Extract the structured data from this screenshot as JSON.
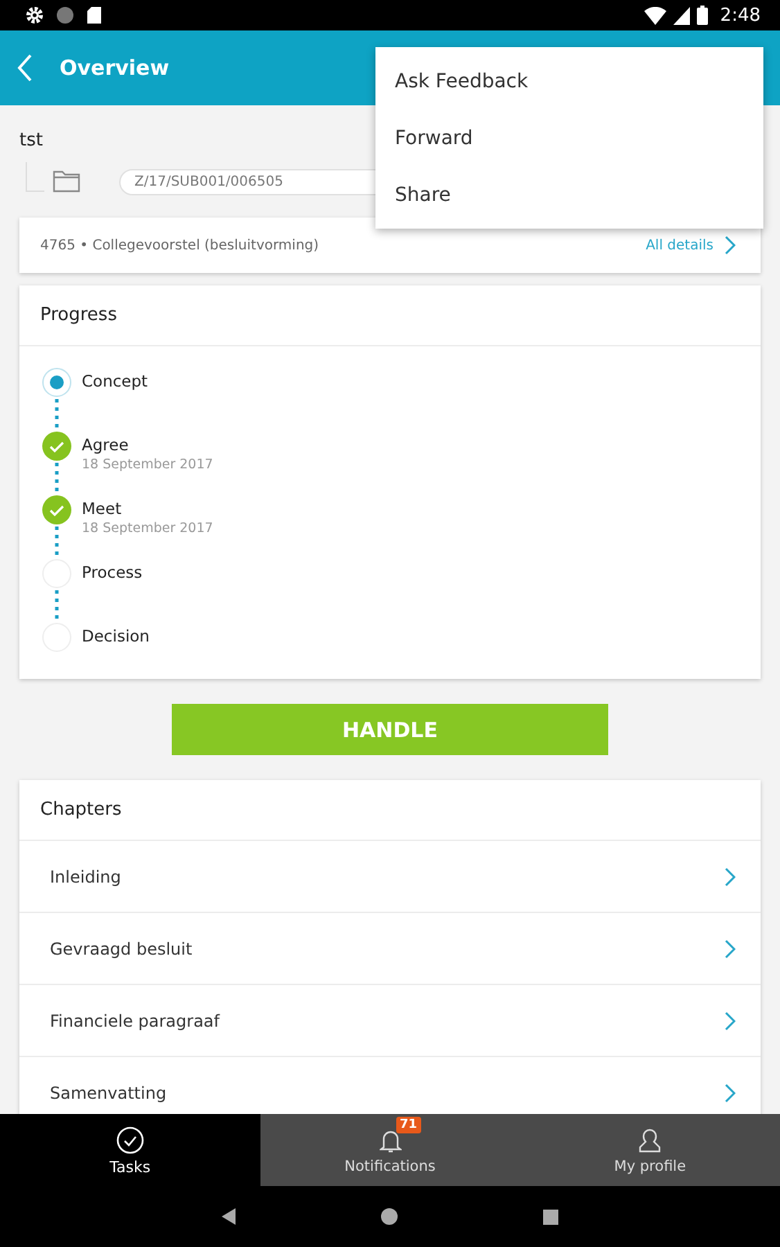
{
  "status_bar": {
    "time": "2:48"
  },
  "app_bar": {
    "title": "Overview"
  },
  "menu": {
    "items": [
      "Ask Feedback",
      "Forward",
      "Share"
    ]
  },
  "case": {
    "title": "tst",
    "path": "Z/17/SUB001/006505"
  },
  "details": {
    "text": "4765 • Collegevoorstel (besluitvorming)",
    "link": "All details"
  },
  "progress": {
    "title": "Progress",
    "steps": [
      {
        "label": "Concept",
        "kind": "current"
      },
      {
        "label": "Agree",
        "kind": "done",
        "date": "18 September 2017"
      },
      {
        "label": "Meet",
        "kind": "done",
        "date": "18 September 2017"
      },
      {
        "label": "Process",
        "kind": "pending"
      },
      {
        "label": "Decision",
        "kind": "pending"
      }
    ]
  },
  "handle_button": "HANDLE",
  "chapters": {
    "title": "Chapters",
    "items": [
      "Inleiding",
      "Gevraagd besluit",
      "Financiele paragraaf",
      "Samenvatting"
    ]
  },
  "bottom_nav": [
    {
      "label": "Tasks",
      "kind": "tasks",
      "selected": true
    },
    {
      "label": "Notifications",
      "kind": "notifications",
      "selected": false,
      "badge": "71"
    },
    {
      "label": "My profile",
      "kind": "profile",
      "selected": false
    }
  ]
}
